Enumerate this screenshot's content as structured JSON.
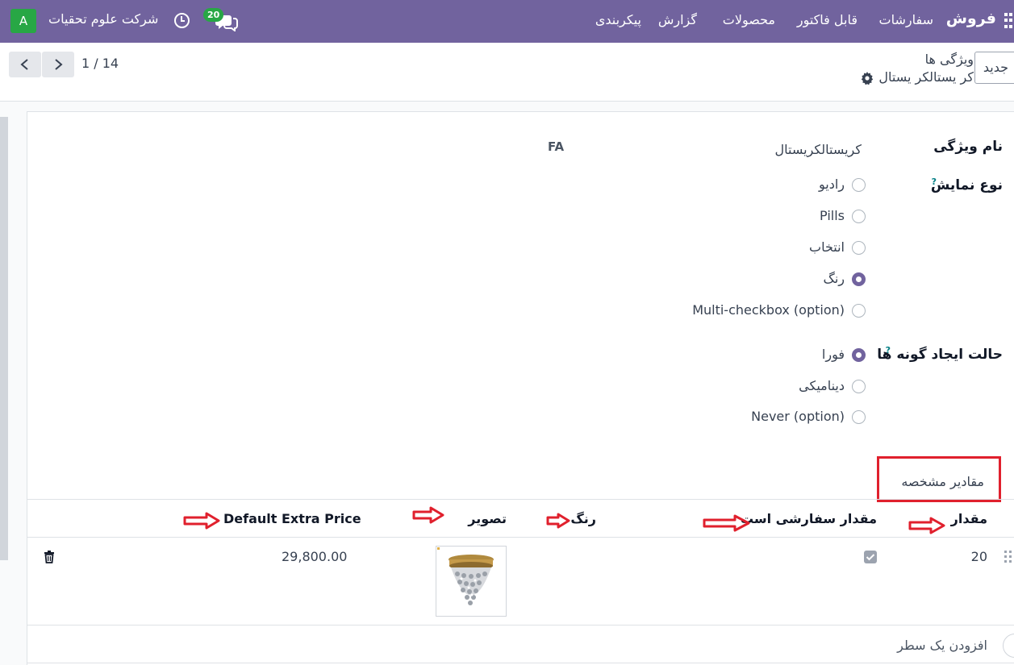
{
  "navbar": {
    "brand": "فروش",
    "menu": [
      "سفارشات",
      "قابل فاکتور",
      "محصولات",
      "گزارش",
      "پیکربندی"
    ],
    "company": "شرکت علوم تحقیات",
    "avatar_letter": "A",
    "message_count": "20",
    "bg_color": "#71639e"
  },
  "control": {
    "new_button": "جدید",
    "breadcrumb_parent": "ویژگی ها",
    "breadcrumb_current": "کر یستالکر یستال",
    "pager": "1 / 14"
  },
  "form": {
    "name_label": "نام ویژگی",
    "name_value": "کریستالکریستال",
    "lang_tag": "FA",
    "display_type_label": "نوع نمایش",
    "display_type_options": [
      {
        "label": "رادیو",
        "checked": false
      },
      {
        "label": "Pills",
        "checked": false
      },
      {
        "label": "انتخاب",
        "checked": false
      },
      {
        "label": "رنگ",
        "checked": true
      },
      {
        "label": "Multi-checkbox (option)",
        "checked": false
      }
    ],
    "variant_mode_label": "حالت ایجاد گونه ها",
    "variant_mode_options": [
      {
        "label": "فورا",
        "checked": true
      },
      {
        "label": "دینامیکی",
        "checked": false
      },
      {
        "label": "Never (option)",
        "checked": false
      }
    ],
    "help_mark": "?"
  },
  "tab": {
    "label": "مقادیر مشخصه"
  },
  "table": {
    "headers": [
      "مقدار",
      "مقدار سفارشی است",
      "رنگ",
      "تصویر",
      "Default Extra Price"
    ],
    "rows": [
      {
        "value": "20",
        "is_custom": true,
        "color": "",
        "image": "chandelier",
        "extra_price": "29,800.00"
      }
    ],
    "add_line": "افزودن یک سطر"
  },
  "annotation_color": "#e0202d"
}
